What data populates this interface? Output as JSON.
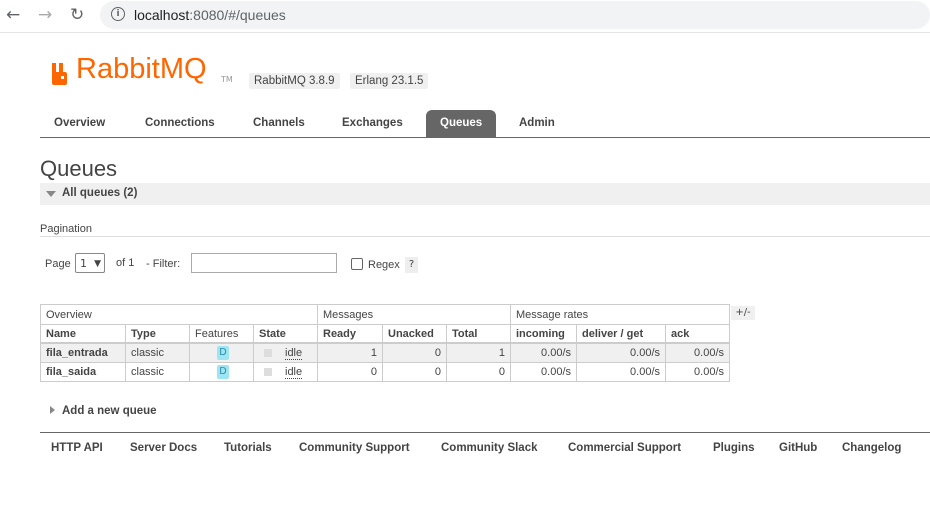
{
  "browser": {
    "url_host": "localhost",
    "url_rest": ":8080/#/queues"
  },
  "header": {
    "brand": "RabbitMQ",
    "tm": "TM",
    "version_badge": "RabbitMQ 3.8.9",
    "erlang_badge": "Erlang 23.1.5",
    "brand_color": "#ff6600"
  },
  "tabs": [
    "Overview",
    "Connections",
    "Channels",
    "Exchanges",
    "Queues",
    "Admin"
  ],
  "active_tab": "Queues",
  "page_title": "Queues",
  "section_title": "All queues (2)",
  "pagination": {
    "label": "Pagination",
    "page_label": "Page",
    "page_value": "1",
    "of_text": "of 1",
    "filter_label": "- Filter:",
    "filter_value": "",
    "regex_label": "Regex",
    "help": "?"
  },
  "table": {
    "groups": [
      "Overview",
      "Messages",
      "Message rates"
    ],
    "columns": [
      "Name",
      "Type",
      "Features",
      "State",
      "Ready",
      "Unacked",
      "Total",
      "incoming",
      "deliver / get",
      "ack"
    ],
    "toggle": "+/-",
    "rows": [
      {
        "name": "fila_entrada",
        "type": "classic",
        "feature": "D",
        "state": "idle",
        "ready": "1",
        "unacked": "0",
        "total": "1",
        "incoming": "0.00/s",
        "deliver": "0.00/s",
        "ack": "0.00/s"
      },
      {
        "name": "fila_saida",
        "type": "classic",
        "feature": "D",
        "state": "idle",
        "ready": "0",
        "unacked": "0",
        "total": "0",
        "incoming": "0.00/s",
        "deliver": "0.00/s",
        "ack": "0.00/s"
      }
    ]
  },
  "add_queue": "Add a new queue",
  "footer_links": [
    "HTTP API",
    "Server Docs",
    "Tutorials",
    "Community Support",
    "Community Slack",
    "Commercial Support",
    "Plugins",
    "GitHub",
    "Changelog"
  ]
}
